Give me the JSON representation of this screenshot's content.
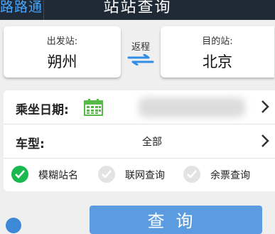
{
  "header": {
    "back_label": "路路通",
    "title": "站站查询"
  },
  "stations": {
    "from_label": "出发站:",
    "from_name": "朔州",
    "swap_label": "返程",
    "to_label": "目的站:",
    "to_name": "北京"
  },
  "options": {
    "date_label": "乘坐日期:",
    "date_value": "",
    "type_label": "车型:",
    "type_value": "全部"
  },
  "checkboxes": [
    {
      "label": "模糊站名",
      "checked": true
    },
    {
      "label": "联网查询",
      "checked": false
    },
    {
      "label": "余票查询",
      "checked": false
    }
  ],
  "query_button": "查询",
  "colors": {
    "header_bg": "#1f2a36",
    "accent_blue": "#5b9be0",
    "check_green": "#19b950"
  }
}
